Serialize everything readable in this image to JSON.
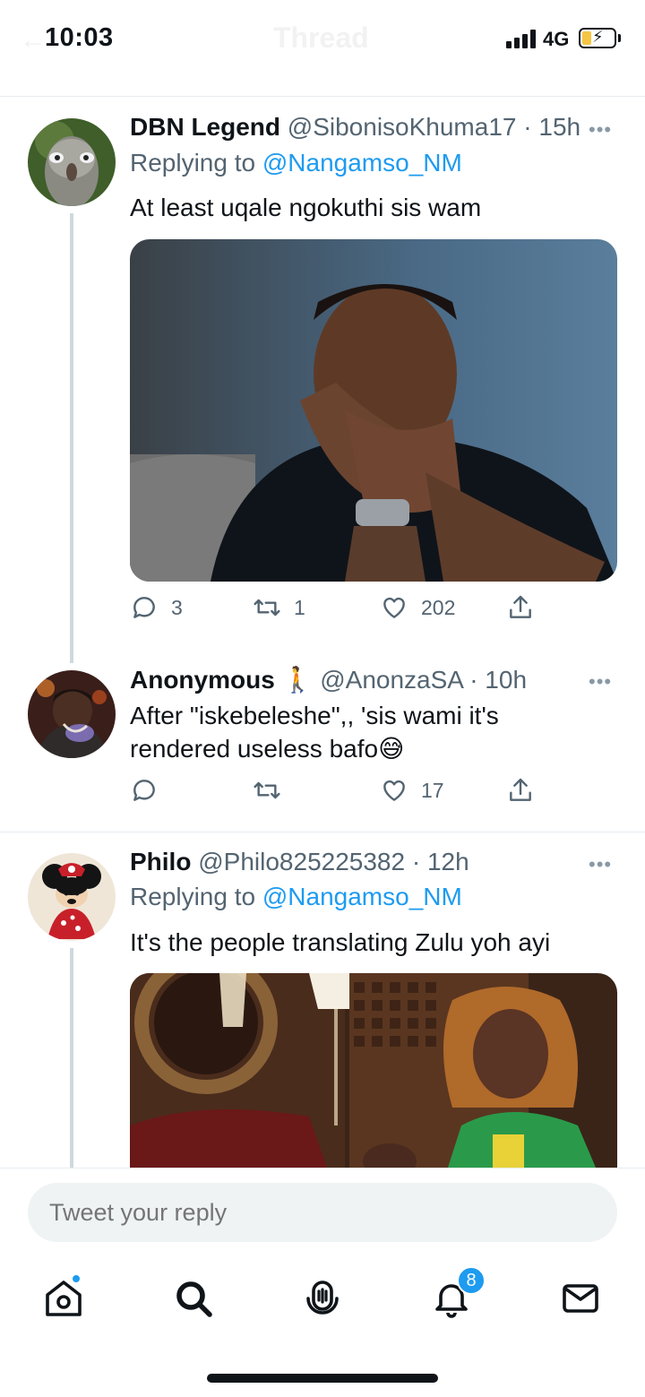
{
  "status_bar": {
    "time": "10:03",
    "network": "4G"
  },
  "header": {
    "title": "Thread"
  },
  "tweets": [
    {
      "name": "DBN Legend",
      "handle": "@SibonisoKhuma17",
      "age": "· 15h",
      "replying_prefix": "Replying to ",
      "replying_to": "@Nangamso_NM",
      "text": "At least uqale ngokuthi sis wam",
      "replies": "3",
      "retweets": "1",
      "likes": "202"
    },
    {
      "name": "Anonymous",
      "name_emoji": "🚶",
      "handle": "@AnonzaSA",
      "age": "· 10h",
      "text_line1": "After \"iskebeleshe\",, 'sis wami it's",
      "text_line2": "rendered useless bafo",
      "text_emoji": "😅",
      "replies": "",
      "retweets": "",
      "likes": "17"
    },
    {
      "name": "Philo",
      "handle": "@Philo825225382",
      "age": "· 12h",
      "replying_prefix": "Replying to ",
      "replying_to": "@Nangamso_NM",
      "text": "It's the people translating Zulu yoh ayi"
    }
  ],
  "reply_box": {
    "placeholder": "Tweet your reply"
  },
  "nav": {
    "notifications_badge": "8"
  },
  "icons": [
    "home-icon",
    "search-icon",
    "spaces-icon",
    "notifications-icon",
    "messages-icon",
    "reply-icon",
    "retweet-icon",
    "like-icon",
    "share-icon",
    "more-icon"
  ],
  "colors": {
    "accent": "#1d9bf0",
    "text": "#0f1419",
    "muted": "#536471",
    "border": "#e6ecf0"
  }
}
